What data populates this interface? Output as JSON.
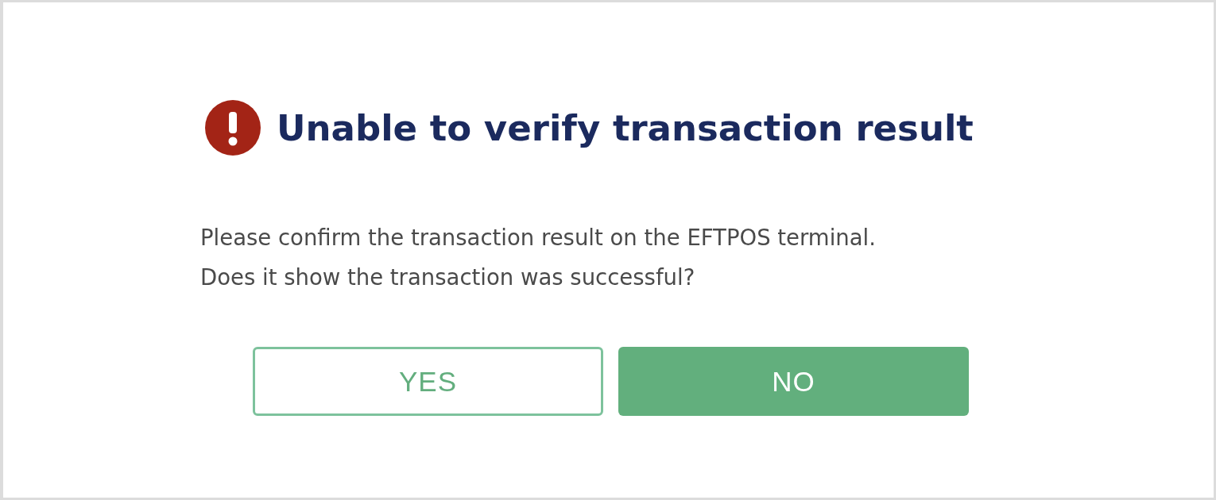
{
  "dialog": {
    "title": "Unable to verify transaction result",
    "message": [
      "Please confirm the transaction result on the EFTPOS terminal.",
      "Does it show the transaction was successful?"
    ],
    "buttons": [
      {
        "label": "YES",
        "kind": "outline"
      },
      {
        "label": "NO",
        "kind": "filled"
      }
    ]
  }
}
